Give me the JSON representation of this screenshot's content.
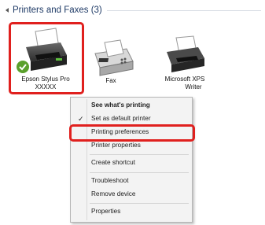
{
  "group": {
    "title": "Printers and Faxes (3)"
  },
  "devices": [
    {
      "name_line1": "Epson Stylus Pro",
      "name_line2": "XXXXX"
    },
    {
      "name_line1": "Fax",
      "name_line2": ""
    },
    {
      "name_line1": "Microsoft XPS",
      "name_line2": "Writer"
    }
  ],
  "menu": {
    "items": [
      {
        "label": "See what's printing"
      },
      {
        "label": "Set as default printer",
        "check": "✓"
      },
      {
        "label": "Printing preferences"
      },
      {
        "label": "Printer properties"
      },
      {
        "label": "Create shortcut"
      },
      {
        "label": "Troubleshoot"
      },
      {
        "label": "Remove device"
      },
      {
        "label": "Properties"
      }
    ]
  },
  "colors": {
    "highlight": "#e0201e",
    "header_text": "#1e3a66"
  }
}
